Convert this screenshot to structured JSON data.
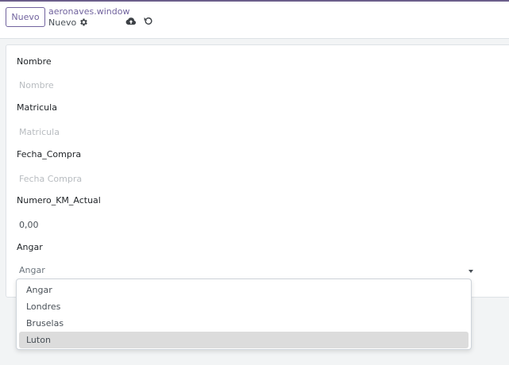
{
  "control_panel": {
    "new_label": "Nuevo",
    "breadcrumb": "aeronaves.window",
    "record_name": "Nuevo",
    "icons": {
      "settings": "gear-icon",
      "save": "cloud-upload-icon",
      "discard": "undo-icon"
    }
  },
  "form": {
    "nombre": {
      "label": "Nombre",
      "value": "",
      "placeholder": "Nombre"
    },
    "matricula": {
      "label": "Matricula",
      "value": "",
      "placeholder": "Matricula"
    },
    "fecha_compra": {
      "label": "Fecha_Compra",
      "value": "",
      "placeholder": "Fecha Compra"
    },
    "numero_km": {
      "label": "Numero_KM_Actual",
      "value": "0,00",
      "placeholder": ""
    },
    "angar": {
      "label": "Angar",
      "selected": "Angar",
      "options": [
        "Angar",
        "Londres",
        "Bruselas",
        "Luton"
      ],
      "highlighted": "Luton"
    }
  },
  "colors": {
    "accent": "#71639e",
    "highlight": "#dcdcdc"
  }
}
